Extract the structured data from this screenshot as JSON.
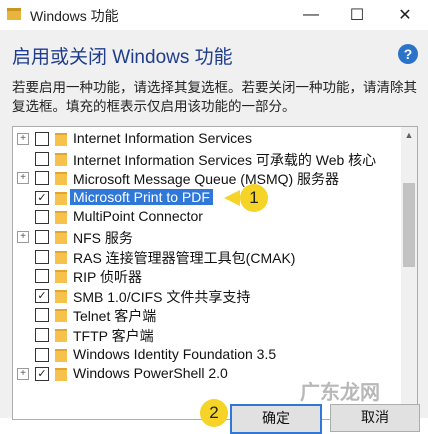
{
  "window": {
    "title": "Windows 功能",
    "controls": {
      "minimize": "—",
      "maximize": "☐",
      "close": "✕"
    }
  },
  "heading": "启用或关闭 Windows 功能",
  "help": "?",
  "description": "若要启用一种功能，请选择其复选框。若要关闭一种功能，请清除其复选框。填充的框表示仅启用该功能的一部分。",
  "features": [
    {
      "label": "Internet Information Services",
      "expandable": true,
      "state": "unchecked"
    },
    {
      "label": "Internet Information Services 可承载的 Web 核心",
      "expandable": false,
      "state": "unchecked"
    },
    {
      "label": "Microsoft Message Queue (MSMQ) 服务器",
      "expandable": true,
      "state": "unchecked"
    },
    {
      "label": "Microsoft Print to PDF",
      "expandable": false,
      "state": "checked",
      "selected": true
    },
    {
      "label": "MultiPoint Connector",
      "expandable": false,
      "state": "unchecked"
    },
    {
      "label": "NFS 服务",
      "expandable": true,
      "state": "unchecked"
    },
    {
      "label": "RAS 连接管理器管理工具包(CMAK)",
      "expandable": false,
      "state": "unchecked"
    },
    {
      "label": "RIP 侦听器",
      "expandable": false,
      "state": "unchecked"
    },
    {
      "label": "SMB 1.0/CIFS 文件共享支持",
      "expandable": false,
      "state": "checked"
    },
    {
      "label": "Telnet 客户端",
      "expandable": false,
      "state": "unchecked"
    },
    {
      "label": "TFTP 客户端",
      "expandable": false,
      "state": "unchecked"
    },
    {
      "label": "Windows Identity Foundation 3.5",
      "expandable": false,
      "state": "unchecked"
    },
    {
      "label": "Windows PowerShell 2.0",
      "expandable": true,
      "state": "checked"
    }
  ],
  "callouts": {
    "first": "1",
    "second": "2"
  },
  "buttons": {
    "ok": "确定",
    "cancel": "取消"
  },
  "watermark": "广东龙网",
  "colors": {
    "selection": "#3078d8",
    "callout": "#f6d327",
    "heading": "#1f3d8c"
  }
}
